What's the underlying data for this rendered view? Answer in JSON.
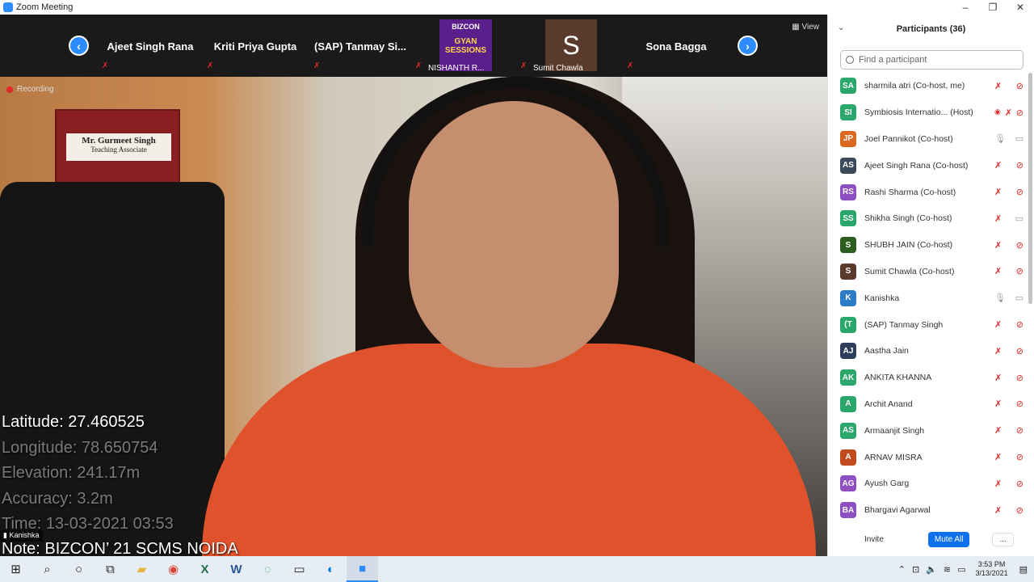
{
  "window": {
    "title": "Zoom Meeting",
    "controls": [
      "–",
      "❐",
      "✕"
    ]
  },
  "strip": {
    "tiles": [
      {
        "name": "Ajeet Singh Rana",
        "sub": ""
      },
      {
        "name": "Kriti Priya Gupta",
        "sub": ""
      },
      {
        "name": "(SAP) Tanmay Si...",
        "sub": ""
      },
      {
        "name": "",
        "sub": "NISHANTH R...",
        "logo_top": "BIZCON",
        "logo_bottom": "GYAN SESSIONS"
      },
      {
        "name": "",
        "sub": "Sumit Chawla",
        "avatar_letter": "S"
      },
      {
        "name": "Sona Bagga",
        "sub": ""
      }
    ],
    "view_label": "View"
  },
  "video": {
    "recording_label": "Recording",
    "nameplate_line1": "Mr. Gurmeet Singh",
    "nameplate_line2": "Teaching Associate",
    "geo": {
      "latitude": "Latitude: 27.460525",
      "longitude": "Longitude: 78.650754",
      "elevation": "Elevation: 241.17m",
      "accuracy": "Accuracy: 3.2m",
      "time": "Time: 13-03-2021  03:53"
    },
    "speaker_tag": "Kanishka",
    "note": "Note: BIZCON’ 21 SCMS NOIDA"
  },
  "panel": {
    "title": "Participants (36)",
    "search_placeholder": "Find a participant",
    "participants": [
      {
        "initials": "SA",
        "name": "sharmila atri (Co-host, me)",
        "color": "#2aa86b",
        "mic": "off",
        "cam": "off"
      },
      {
        "initials": "SI",
        "name": "Symbiosis Internatio... (Host)",
        "color": "#2aa86b",
        "mic": "off",
        "cam": "off",
        "recording": true
      },
      {
        "initials": "JP",
        "name": "Joel Pannikot (Co-host)",
        "color": "#d9691e",
        "mic": "on",
        "cam": "on"
      },
      {
        "initials": "AS",
        "name": "Ajeet Singh Rana (Co-host)",
        "color": "#3b4a5a",
        "mic": "off",
        "cam": "off"
      },
      {
        "initials": "RS",
        "name": "Rashi Sharma (Co-host)",
        "color": "#8e4fc3",
        "mic": "off",
        "cam": "off"
      },
      {
        "initials": "SS",
        "name": "Shikha Singh (Co-host)",
        "color": "#2aa86b",
        "mic": "off",
        "cam": "on"
      },
      {
        "initials": "S",
        "name": "SHUBH JAIN (Co-host)",
        "color": "#2e5e1f",
        "mic": "off",
        "cam": "off"
      },
      {
        "initials": "S",
        "name": "Sumit Chawla (Co-host)",
        "color": "#5a3a2a",
        "mic": "off",
        "cam": "off"
      },
      {
        "initials": "K",
        "name": "Kanishka",
        "color": "#2b7bc6",
        "mic": "on",
        "cam": "on"
      },
      {
        "initials": "(T",
        "name": "(SAP) Tanmay Singh",
        "color": "#2aa86b",
        "mic": "off",
        "cam": "off"
      },
      {
        "initials": "AJ",
        "name": "Aastha Jain",
        "color": "#2e3e5a",
        "mic": "off",
        "cam": "off"
      },
      {
        "initials": "AK",
        "name": "ANKITA KHANNA",
        "color": "#2aa86b",
        "mic": "off",
        "cam": "off"
      },
      {
        "initials": "A",
        "name": "Archit Anand",
        "color": "#2aa86b",
        "mic": "off",
        "cam": "off"
      },
      {
        "initials": "AS",
        "name": "Armaanjit Singh",
        "color": "#2aa86b",
        "mic": "off",
        "cam": "off"
      },
      {
        "initials": "A",
        "name": "ARNAV MISRA",
        "color": "#c24b1e",
        "mic": "off",
        "cam": "off"
      },
      {
        "initials": "AG",
        "name": "Ayush Garg",
        "color": "#8e4fc3",
        "mic": "off",
        "cam": "off"
      },
      {
        "initials": "BA",
        "name": "Bhargavi Agarwal",
        "color": "#8e4fc3",
        "mic": "off",
        "cam": "off"
      }
    ],
    "invite_label": "Invite",
    "mute_all_label": "Mute All",
    "more_label": "..."
  },
  "taskbar": {
    "time": "3:53 PM",
    "date": "3/13/2021"
  }
}
